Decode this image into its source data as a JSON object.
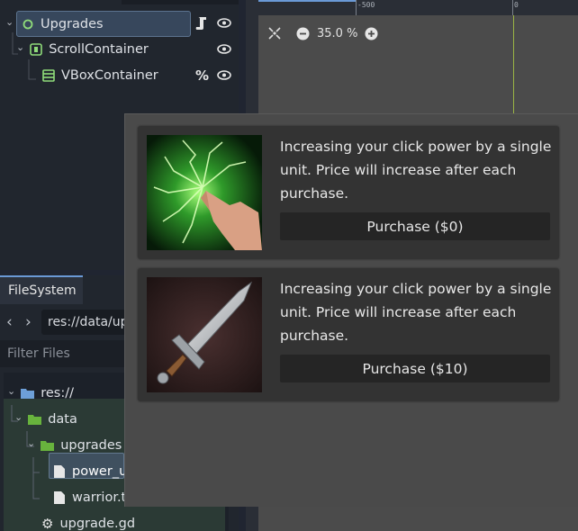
{
  "scene_tree": {
    "nodes": [
      {
        "label": "Upgrades",
        "icon": "control-node-icon"
      },
      {
        "label": "ScrollContainer",
        "icon": "scroll-container-icon"
      },
      {
        "label": "VBoxContainer",
        "icon": "vbox-container-icon"
      }
    ],
    "vbox_badge": "%"
  },
  "filesystem": {
    "tab_label": "FileSystem",
    "path": "res://data/up",
    "filter_placeholder": "Filter Files",
    "items": [
      {
        "label": "res://",
        "icon": "folder-icon"
      },
      {
        "label": "data",
        "icon": "folder-icon"
      },
      {
        "label": "upgrades",
        "icon": "folder-icon"
      },
      {
        "label": "power_up",
        "icon": "file-icon"
      },
      {
        "label": "warrior.tr",
        "icon": "file-icon"
      },
      {
        "label": "upgrade.gd",
        "icon": "gear-icon"
      }
    ]
  },
  "viewport": {
    "ruler_labels": [
      "-500",
      "0"
    ],
    "zoom": "35.0 %"
  },
  "game": {
    "upgrades": [
      {
        "description": "Increasing your click power by a single unit. Price will increase after each purchase.",
        "button_label": "Purchase ($0)",
        "image": "green-lightning-hand"
      },
      {
        "description": "Increasing your click power by a single unit. Price will increase after each purchase.",
        "button_label": "Purchase ($10)",
        "image": "steel-sword"
      }
    ]
  },
  "colors": {
    "accent": "#6a99d6",
    "selection": "#37475c",
    "folder": "#68b33d",
    "guide": "#9bb545"
  }
}
